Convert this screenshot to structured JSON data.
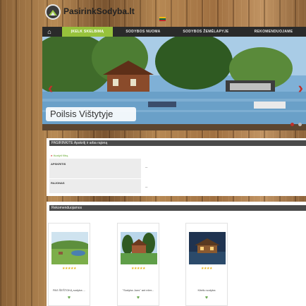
{
  "site": {
    "logo_text": "PasirinkSodyba.lt"
  },
  "nav": {
    "items": [
      "ĮKELK SKELBIMĄ",
      "SODYBOS NUOMA",
      "SODYBOS ŽEMĖLAPYJE",
      "REKOMENDUOJAME"
    ]
  },
  "hero": {
    "caption": "Poilsis Vištytyje",
    "slides": 2,
    "active_slide": 1
  },
  "search": {
    "header": "PASIRINKITE Apskritį ir arba rajoną",
    "clear_filters": "Išvalyti filtrą",
    "county_label": "APSKRITIS",
    "county_value": "--",
    "district_label": "RAJONAS",
    "district_value": "--"
  },
  "recommended": {
    "header": "Rekomenduojamos",
    "cards": [
      {
        "title": "PAS ŠEŠTOKĄ sodyba ...",
        "stars": "★★★★★"
      },
      {
        "title": "\"Sodyba Juns\" ant ežer...",
        "stars": "★★★★★"
      },
      {
        "title": "Kiteliu sodyba",
        "stars": "★★★★"
      }
    ]
  },
  "colors": {
    "nav_active": "#97c23c",
    "nav_bg": "#2a2a2a",
    "accent_red": "#c0302a"
  }
}
